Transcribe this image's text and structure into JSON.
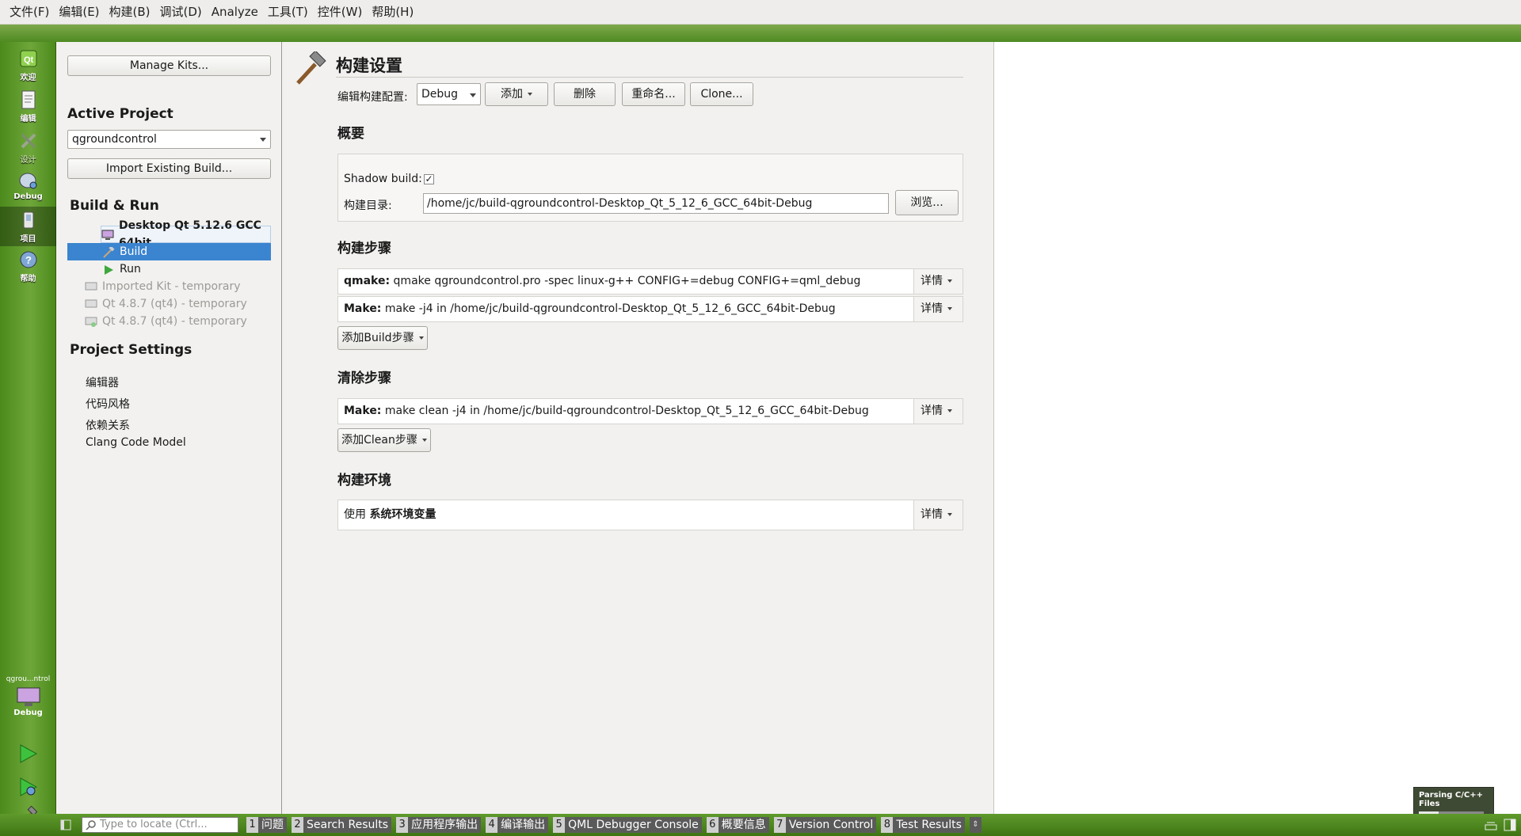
{
  "menubar": {
    "items": [
      "文件(F)",
      "编辑(E)",
      "构建(B)",
      "调试(D)",
      "Analyze",
      "工具(T)",
      "控件(W)",
      "帮助(H)"
    ]
  },
  "modebar": {
    "modes": [
      {
        "label": "欢迎",
        "icon": "qt-logo-icon"
      },
      {
        "label": "编辑",
        "icon": "document-edit-icon"
      },
      {
        "label": "设计",
        "icon": "design-pencil-icon"
      },
      {
        "label": "Debug",
        "icon": "debug-bug-icon"
      },
      {
        "label": "项目",
        "icon": "project-wrench-icon"
      },
      {
        "label": "帮助",
        "icon": "help-question-icon"
      }
    ],
    "target_project": "qgrou...ntrol",
    "target_config": "Debug"
  },
  "leftpanel": {
    "manage_kits": "Manage Kits...",
    "active_project_title": "Active Project",
    "active_project_value": "qgroundcontrol",
    "import_build": "Import Existing Build...",
    "build_run_title": "Build & Run",
    "kit_name": "Desktop Qt 5.12.6 GCC 64bit",
    "build_label": "Build",
    "run_label": "Run",
    "other_kits": [
      "Imported Kit - temporary",
      "Qt 4.8.7 (qt4) - temporary",
      "Qt 4.8.7 (qt4) - temporary"
    ],
    "project_settings_title": "Project Settings",
    "settings_items": [
      "编辑器",
      "代码风格",
      "依赖关系",
      "Clang Code Model"
    ]
  },
  "main": {
    "title": "构建设置",
    "edit_config_label": "编辑构建配置:",
    "config_value": "Debug",
    "add_button": "添加",
    "delete_button": "删除",
    "rename_button": "重命名...",
    "clone_button": "Clone...",
    "general_title": "概要",
    "shadow_build_label": "Shadow build:",
    "shadow_build_checked": "✓",
    "build_dir_label": "构建目录:",
    "build_dir_value": "/home/jc/build-qgroundcontrol-Desktop_Qt_5_12_6_GCC_64bit-Debug",
    "browse_button": "浏览...",
    "build_steps_title": "构建步骤",
    "build_steps": [
      {
        "tool": "qmake:",
        "text": " qmake qgroundcontrol.pro -spec linux-g++ CONFIG+=debug CONFIG+=qml_debug"
      },
      {
        "tool": "Make:",
        "text": " make -j4 in /home/jc/build-qgroundcontrol-Desktop_Qt_5_12_6_GCC_64bit-Debug"
      }
    ],
    "add_build_step": "添加Build步骤",
    "clean_steps_title": "清除步骤",
    "clean_steps": [
      {
        "tool": "Make:",
        "text": " make clean -j4 in /home/jc/build-qgroundcontrol-Desktop_Qt_5_12_6_GCC_64bit-Debug"
      }
    ],
    "add_clean_step": "添加Clean步骤",
    "env_title": "构建环境",
    "env_prefix": "使用 ",
    "env_value": "系统环境变量",
    "details_label": "详情"
  },
  "statusbar": {
    "locate_placeholder": "Type to locate (Ctrl...",
    "panes": [
      {
        "num": "1",
        "label": "问题"
      },
      {
        "num": "2",
        "label": "Search Results"
      },
      {
        "num": "3",
        "label": "应用程序输出"
      },
      {
        "num": "4",
        "label": "编译输出"
      },
      {
        "num": "5",
        "label": "QML Debugger Console"
      },
      {
        "num": "6",
        "label": "概要信息"
      },
      {
        "num": "7",
        "label": "Version Control"
      },
      {
        "num": "8",
        "label": "Test Results"
      }
    ],
    "parsing_label": "Parsing C/C++ Files",
    "parsing_progress": 0.3
  },
  "colors": {
    "accent_green": "#5f9a2c",
    "selection_blue": "#3b84cf"
  }
}
